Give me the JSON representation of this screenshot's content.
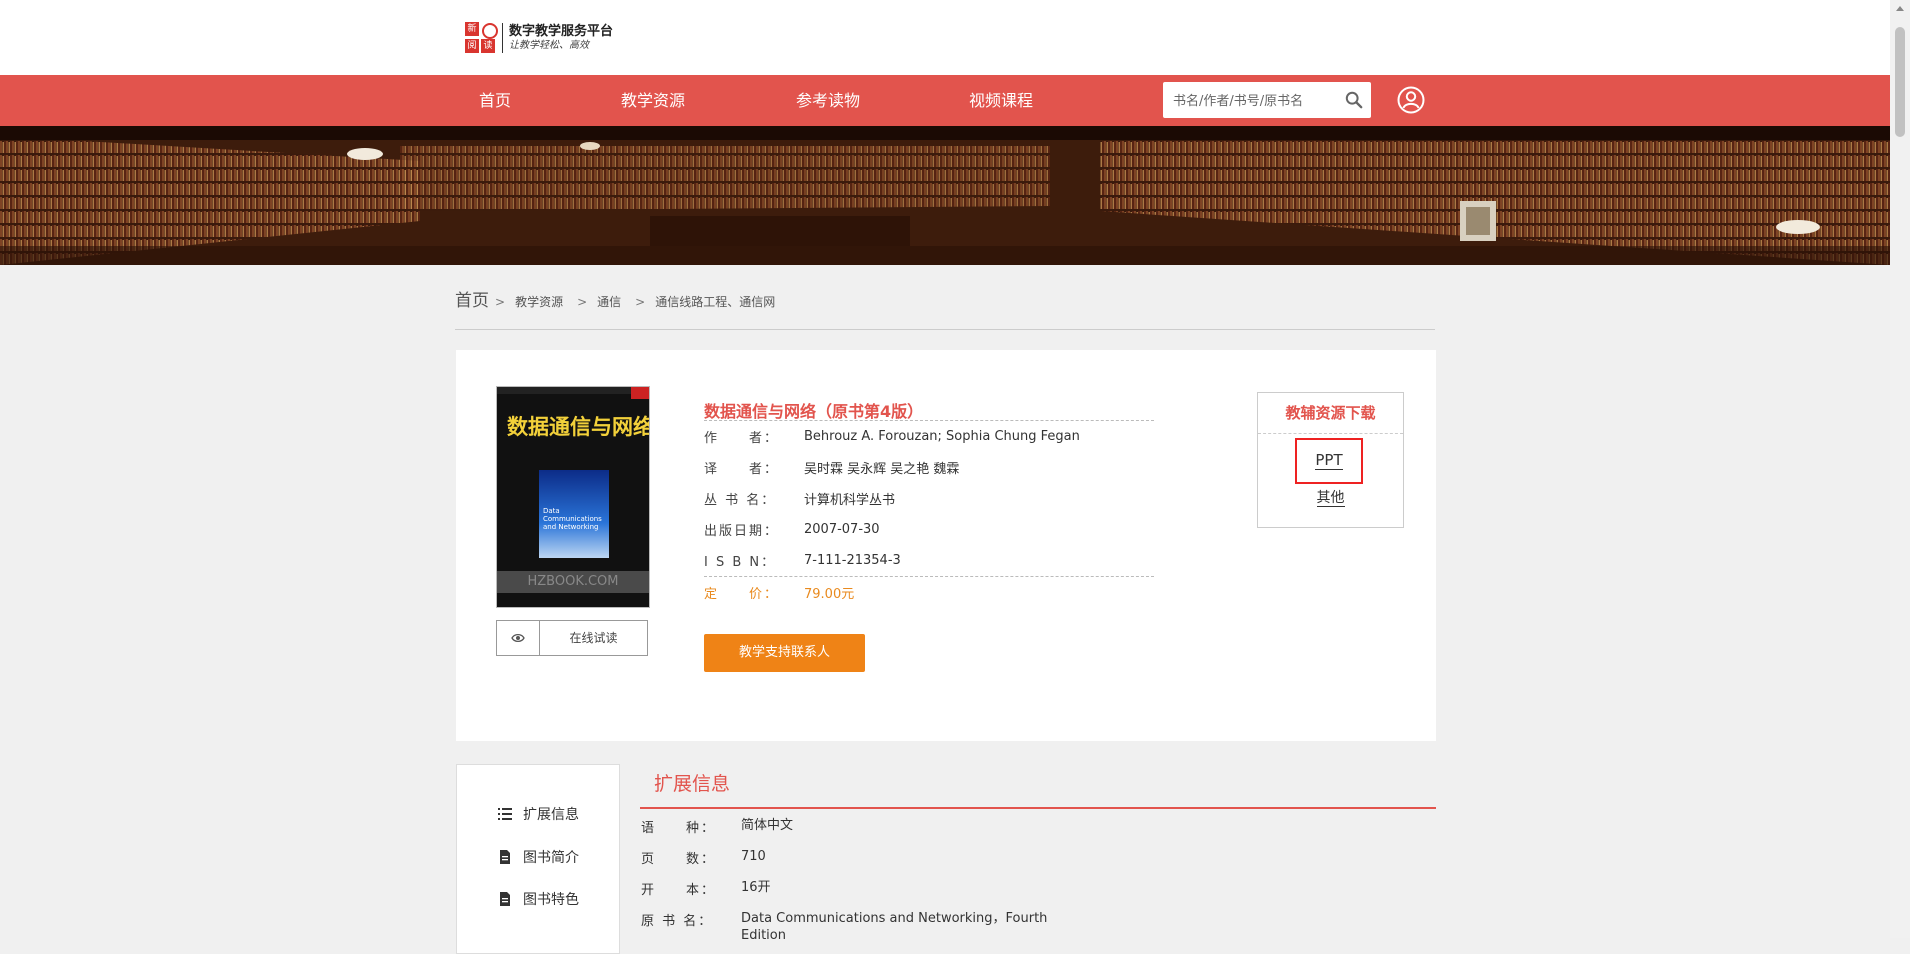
{
  "logo": {
    "mark_left": "新",
    "mark_bottom1": "阅",
    "mark_bottom2": "读",
    "title": "数字教学服务平台",
    "subtitle": "让教学轻松、高效"
  },
  "nav": {
    "items": [
      "首页",
      "教学资源",
      "参考读物",
      "视频课程"
    ],
    "search_placeholder": "书名/作者/书号/原书名",
    "color": "#e2544d"
  },
  "breadcrumb": {
    "home": "首页",
    "items": [
      "教学资源",
      "通信",
      "通信线路工程、通信网"
    ],
    "separator": ">"
  },
  "book": {
    "cover": {
      "title": "数据通信与网络",
      "english": "Data Communications and Networking",
      "watermark": "HZBOOK.COM"
    },
    "preview_label": "在线试读",
    "title": "数据通信与网络（原书第4版）",
    "fields": [
      {
        "key": "作　　者：",
        "value": "Behrouz A. Forouzan; Sophia Chung Fegan"
      },
      {
        "key": "译　　者：",
        "value": "吴时霖 吴永辉 吴之艳 魏霖"
      },
      {
        "key": "丛 书 名：",
        "value": "计算机科学丛书"
      },
      {
        "key": "出版日期：",
        "value": "2007-07-30"
      },
      {
        "key": "I S B N：",
        "value": "7-111-21354-3"
      }
    ],
    "price_key": "定　　价：",
    "price_value": "79.00元",
    "support_button": "教学支持联系人"
  },
  "download": {
    "title": "教辅资源下载",
    "ppt": "PPT",
    "other": "其他"
  },
  "sidebar": {
    "items": [
      {
        "label": "扩展信息",
        "icon": "list-icon"
      },
      {
        "label": "图书简介",
        "icon": "document-icon"
      },
      {
        "label": "图书特色",
        "icon": "document-icon"
      }
    ]
  },
  "extended": {
    "title": "扩展信息",
    "rows": [
      {
        "key": "语　　种：",
        "value": "简体中文"
      },
      {
        "key": "页　　数：",
        "value": "710"
      },
      {
        "key": "开　　本：",
        "value": "16开"
      },
      {
        "key": "原 书 名：",
        "value": "Data Communications and Networking，Fourth Edition"
      }
    ]
  }
}
